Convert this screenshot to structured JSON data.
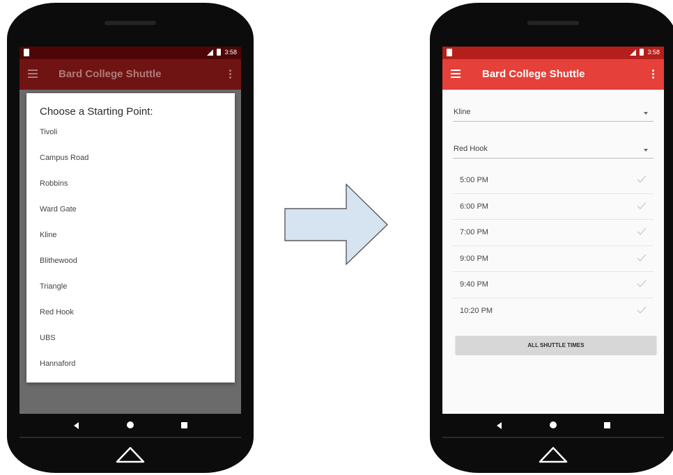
{
  "colors": {
    "left_status": "#4e0505",
    "left_appbar": "#701413",
    "right_status": "#b51f1b",
    "right_appbar": "#e5403a",
    "arrow_fill": "#d6e4f1"
  },
  "left_phone": {
    "status_time": "3:58",
    "app_title": "Bard College Shuttle",
    "dialog": {
      "title": "Choose a Starting Point:",
      "options": [
        "Tivoli",
        "Campus Road",
        "Robbins",
        "Ward Gate",
        "Kline",
        "Blithewood",
        "Triangle",
        "Red Hook",
        "UBS",
        "Hannaford"
      ]
    }
  },
  "right_phone": {
    "status_time": "3:58",
    "app_title": "Bard College Shuttle",
    "from_spinner": "Kline",
    "to_spinner": "Red Hook",
    "times": [
      "5:00 PM",
      "6:00 PM",
      "7:00 PM",
      "9:00 PM",
      "9:40 PM",
      "10:20 PM"
    ],
    "all_times_button": "ALL SHUTTLE TIMES"
  },
  "icons": {
    "menu": "menu-icon",
    "overflow": "overflow-icon",
    "check": "check-icon",
    "back": "back-icon",
    "home": "home-icon",
    "recents": "recents-icon",
    "arrow": "right-arrow"
  }
}
